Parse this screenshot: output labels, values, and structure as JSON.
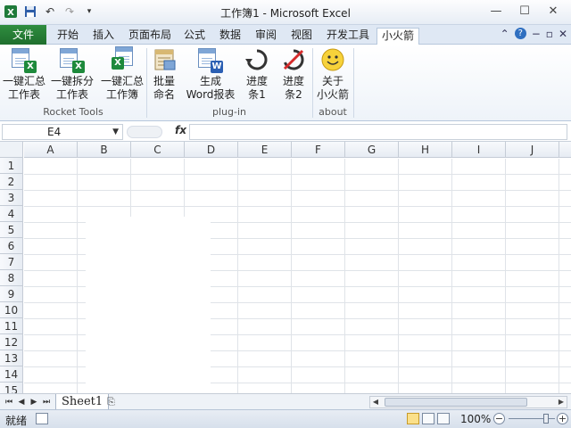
{
  "title_bar": {
    "title": "工作簿1 - Microsoft Excel",
    "qat_icons": [
      "excel-app-icon",
      "save-icon",
      "undo-icon",
      "redo-icon",
      "customize-qat-icon"
    ],
    "window_buttons": [
      "minimize-icon",
      "maximize-icon",
      "close-icon"
    ]
  },
  "tabs": {
    "file": "文件",
    "items": [
      "开始",
      "插入",
      "页面布局",
      "公式",
      "数据",
      "审阅",
      "视图",
      "开发工具",
      "小火箭"
    ],
    "active": "小火箭"
  },
  "ribbon": {
    "groups": [
      {
        "label": "Rocket Tools",
        "buttons": [
          {
            "line1": "一键汇总",
            "line2": "工作表",
            "icon": "merge-sheets-icon"
          },
          {
            "line1": "一键拆分",
            "line2": "工作表",
            "icon": "split-sheets-icon"
          },
          {
            "line1": "一键汇总",
            "line2": "工作簿",
            "icon": "merge-workbooks-icon"
          }
        ]
      },
      {
        "label": "plug-in",
        "buttons": [
          {
            "line1": "批量",
            "line2": "命名",
            "icon": "batch-rename-icon"
          },
          {
            "line1": "生成",
            "line2": "Word报表",
            "icon": "word-report-icon"
          },
          {
            "line1": "进度",
            "line2": "条1",
            "icon": "progress-refresh-icon"
          },
          {
            "line1": "进度",
            "line2": "条2",
            "icon": "progress-cancel-icon"
          }
        ]
      },
      {
        "label": "about",
        "buttons": [
          {
            "line1": "关于",
            "line2": "小火箭",
            "icon": "smiley-icon"
          }
        ]
      }
    ]
  },
  "formula_bar": {
    "name_box": "E4",
    "fx_label": "fx",
    "formula": ""
  },
  "grid": {
    "columns": [
      "A",
      "B",
      "C",
      "D",
      "E",
      "F",
      "G",
      "H",
      "I",
      "J"
    ],
    "rows": [
      "1",
      "2",
      "3",
      "4",
      "5",
      "6",
      "7",
      "8",
      "9",
      "10",
      "11",
      "12",
      "13",
      "14",
      "15"
    ]
  },
  "sheets": {
    "tabs": [
      "Sheet1"
    ]
  },
  "status_bar": {
    "ready": "就绪",
    "zoom": "100%",
    "zoom_minus": "−",
    "zoom_plus": "+"
  },
  "colors": {
    "file_tab": "#1f6f2e",
    "ribbon_bg": "#eef3f9",
    "grid_line": "#dfe3e8"
  }
}
